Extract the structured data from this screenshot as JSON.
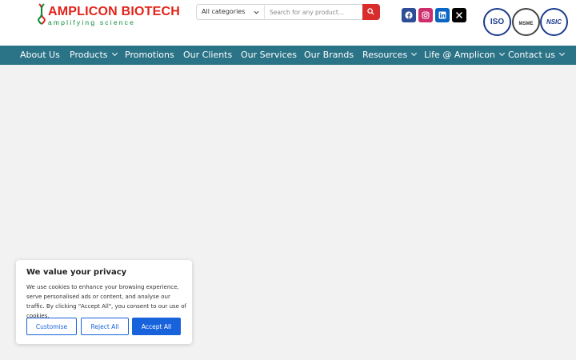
{
  "brand": {
    "name_part1": "AMPLICON",
    "name_part2": "BIOTECH",
    "tagline": "amplifying science"
  },
  "search": {
    "category_selected": "All categories",
    "placeholder": "Search for any product...",
    "icon": "search-icon"
  },
  "social": [
    {
      "name": "facebook-icon"
    },
    {
      "name": "instagram-icon"
    },
    {
      "name": "linkedin-icon"
    },
    {
      "name": "x-icon"
    }
  ],
  "certifications": {
    "iso": "ISO",
    "msme": "MSME",
    "nsic": "NSIC"
  },
  "nav": {
    "items": [
      {
        "label": "About Us",
        "dropdown": false
      },
      {
        "label": "Products",
        "dropdown": true
      },
      {
        "label": "Promotions",
        "dropdown": false
      },
      {
        "label": "Our Clients",
        "dropdown": false
      },
      {
        "label": "Our Services",
        "dropdown": false
      },
      {
        "label": "Our Brands",
        "dropdown": false
      },
      {
        "label": "Resources",
        "dropdown": true
      },
      {
        "label": "Life @ Amplicon",
        "dropdown": true
      },
      {
        "label": "Contact us",
        "dropdown": true
      }
    ]
  },
  "cookie": {
    "title": "We value your privacy",
    "body": "We use cookies to enhance your browsing experience, serve personalised ads or content, and analyse our traffic. By clicking \"Accept All\", you consent to our use of cookies.",
    "customise": "Customise",
    "reject": "Reject All",
    "accept": "Accept All"
  },
  "colors": {
    "nav_bg": "#2b7387",
    "brand_red": "#e2231a",
    "brand_green": "#0a8a3a",
    "search_button": "#d92c2c",
    "cookie_accent": "#1863dc"
  }
}
